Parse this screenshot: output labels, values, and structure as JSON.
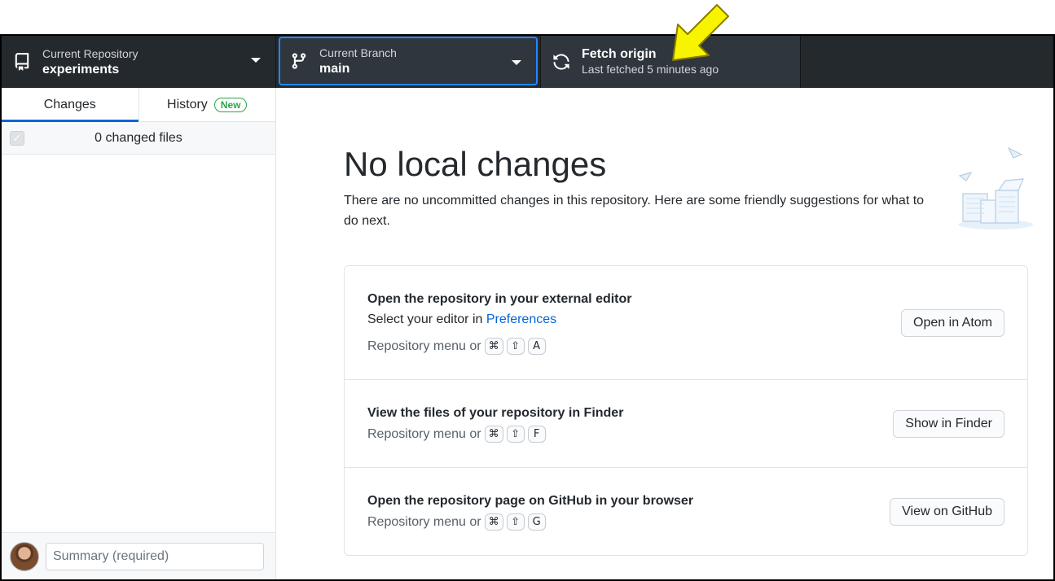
{
  "toolbar": {
    "repository": {
      "label": "Current Repository",
      "value": "experiments"
    },
    "branch": {
      "label": "Current Branch",
      "value": "main"
    },
    "fetch": {
      "title": "Fetch origin",
      "subtitle": "Last fetched 5 minutes ago"
    }
  },
  "sidebar": {
    "tabs": [
      {
        "label": "Changes",
        "active": true
      },
      {
        "label": "History",
        "badge": "New"
      }
    ],
    "changed_files": "0 changed files",
    "summary_placeholder": "Summary (required)"
  },
  "main": {
    "heading": "No local changes",
    "intro": "There are no uncommitted changes in this repository. Here are some friendly suggestions for what to do next.",
    "suggestions": [
      {
        "title": "Open the repository in your external editor",
        "desc_prefix": "Select your editor in ",
        "desc_link": "Preferences",
        "shortcut_prefix": "Repository menu or",
        "keys": [
          "⌘",
          "⇧",
          "A"
        ],
        "button": "Open in Atom"
      },
      {
        "title": "View the files of your repository in Finder",
        "shortcut_prefix": "Repository menu or",
        "keys": [
          "⌘",
          "⇧",
          "F"
        ],
        "button": "Show in Finder"
      },
      {
        "title": "Open the repository page on GitHub in your browser",
        "shortcut_prefix": "Repository menu or",
        "keys": [
          "⌘",
          "⇧",
          "G"
        ],
        "button": "View on GitHub"
      }
    ]
  },
  "icons": {
    "repo": "repo-icon",
    "branch": "git-branch-icon",
    "fetch": "sync-icon",
    "annotation": "yellow-arrow-icon"
  },
  "colors": {
    "toolbar_bg": "#24292e",
    "accent": "#0366d6",
    "badge_green": "#28a745",
    "arrow_yellow": "#f8f400"
  }
}
